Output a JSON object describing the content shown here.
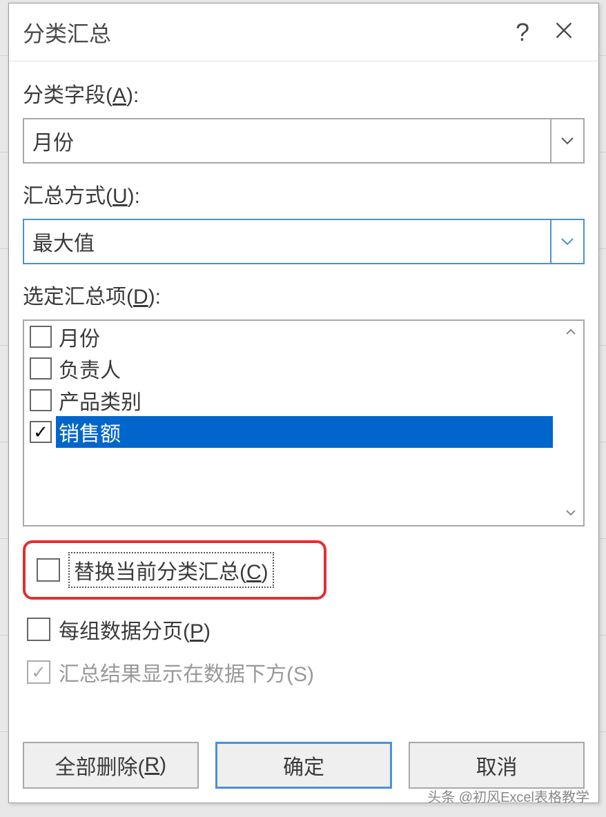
{
  "dialog": {
    "title": "分类汇总",
    "help_symbol": "?"
  },
  "groupby": {
    "label_before": "分类字段(",
    "label_key": "A",
    "label_after": "):",
    "value": "月份"
  },
  "function": {
    "label_before": "汇总方式(",
    "label_key": "U",
    "label_after": "):",
    "value": "最大值"
  },
  "items": {
    "label_before": "选定汇总项(",
    "label_key": "D",
    "label_after": "):",
    "options": [
      {
        "label": "月份",
        "checked": false,
        "selected": false
      },
      {
        "label": "负责人",
        "checked": false,
        "selected": false
      },
      {
        "label": "产品类别",
        "checked": false,
        "selected": false
      },
      {
        "label": "销售额",
        "checked": true,
        "selected": true
      }
    ]
  },
  "checks": {
    "replace": {
      "before": "替换当前分类汇总(",
      "key": "C",
      "after": ")",
      "checked": false
    },
    "pagebreak": {
      "before": "每组数据分页(",
      "key": "P",
      "after": ")",
      "checked": false
    },
    "below": {
      "label": "汇总结果显示在数据下方(S)",
      "checked": true,
      "disabled": true
    }
  },
  "buttons": {
    "remove": {
      "before": "全部删除(",
      "key": "R",
      "after": ")"
    },
    "ok": "确定",
    "cancel": "取消"
  },
  "watermark": "头条 @初风Excel表格教学"
}
